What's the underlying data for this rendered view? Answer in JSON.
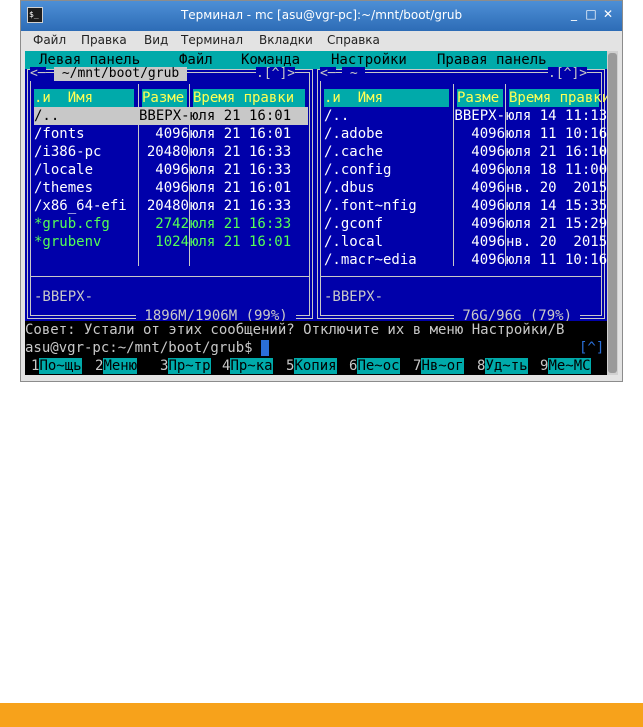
{
  "window": {
    "title": "Терминал - mc [asu@vgr-pc]:~/mnt/boot/grub",
    "controls": {
      "minimize": "_",
      "maximize": "□",
      "close": "✕"
    },
    "icon": "terminal-icon"
  },
  "menubar": [
    "Файл",
    "Правка",
    "Вид",
    "Терминал",
    "Вкладки",
    "Справка"
  ],
  "mc_menu": [
    "Левая панель",
    "Файл",
    "Команда",
    "Настройки",
    "Правая панель"
  ],
  "left_panel": {
    "path": " ~/mnt/boot/grub ",
    "corner_left": "<─",
    "corner_right": ".[^]>",
    "headers": {
      "name_sort": ".и",
      "name": "Имя",
      "size": "Разме",
      "mtime": "Время правки"
    },
    "rows": [
      {
        "name": "/..",
        "size": "ВВЕРХ-",
        "mtime": "юля 21 16:01",
        "selected": true
      },
      {
        "name": "/fonts",
        "size": "4096",
        "mtime": "юля 21 16:01"
      },
      {
        "name": "/i386-pc",
        "size": "20480",
        "mtime": "юля 21 16:33"
      },
      {
        "name": "/locale",
        "size": "4096",
        "mtime": "юля 21 16:33"
      },
      {
        "name": "/themes",
        "size": "4096",
        "mtime": "юля 21 16:01"
      },
      {
        "name": "/x86_64-efi",
        "size": "20480",
        "mtime": "юля 21 16:33"
      },
      {
        "name": "*grub.cfg",
        "size": "2742",
        "mtime": "юля 21 16:33",
        "exec": true
      },
      {
        "name": "*grubenv",
        "size": "1024",
        "mtime": "юля 21 16:01",
        "exec": true
      }
    ],
    "mini_status": "-ВВЕРХ-",
    "disk_usage": " 1896M/1906M (99%) "
  },
  "right_panel": {
    "path": " ~ ",
    "corner_left": "<─",
    "corner_right": ".[^]>",
    "headers": {
      "name_sort": ".и",
      "name": "Имя",
      "size": "Разме",
      "mtime": "Время правки"
    },
    "rows": [
      {
        "name": "/..",
        "size": "ВВЕРХ-",
        "mtime": "юля 14 11:13"
      },
      {
        "name": "/.adobe",
        "size": "4096",
        "mtime": "юля 11 10:16"
      },
      {
        "name": "/.cache",
        "size": "4096",
        "mtime": "юля 21 16:10"
      },
      {
        "name": "/.config",
        "size": "4096",
        "mtime": "юля 18 11:00"
      },
      {
        "name": "/.dbus",
        "size": "4096",
        "mtime": "нв. 20  2015"
      },
      {
        "name": "/.font~nfig",
        "size": "4096",
        "mtime": "юля 14 15:35"
      },
      {
        "name": "/.gconf",
        "size": "4096",
        "mtime": "юля 21 15:29"
      },
      {
        "name": "/.local",
        "size": "4096",
        "mtime": "нв. 20  2015"
      },
      {
        "name": "/.macr~edia",
        "size": "4096",
        "mtime": "юля 11 10:16"
      }
    ],
    "mini_status": "-ВВЕРХ-",
    "disk_usage": " 76G/96G (79%) "
  },
  "hint": "Совет: Устали от этих сообщений? Отключите их в меню Настройки/В",
  "prompt": "asu@vgr-pc:~/mnt/boot/grub$",
  "prompt_history": "[^]",
  "fkeys": [
    {
      "n": "1",
      "label": "По~щь"
    },
    {
      "n": "2",
      "label": "Меню"
    },
    {
      "n": "3",
      "label": "Пр~тр"
    },
    {
      "n": "4",
      "label": "Пр~ка"
    },
    {
      "n": "5",
      "label": "Копия"
    },
    {
      "n": "6",
      "label": "Пе~ос"
    },
    {
      "n": "7",
      "label": "Нв~ог"
    },
    {
      "n": "8",
      "label": "Уд~ть"
    },
    {
      "n": "9",
      "label": "Ме~МС"
    }
  ],
  "colors": {
    "panel_bg": "#0000aa",
    "header_bg": "#00aaaa",
    "header_fg": "#ffff55",
    "exec_fg": "#55ff55",
    "accent_bar": "#f7a21b"
  }
}
